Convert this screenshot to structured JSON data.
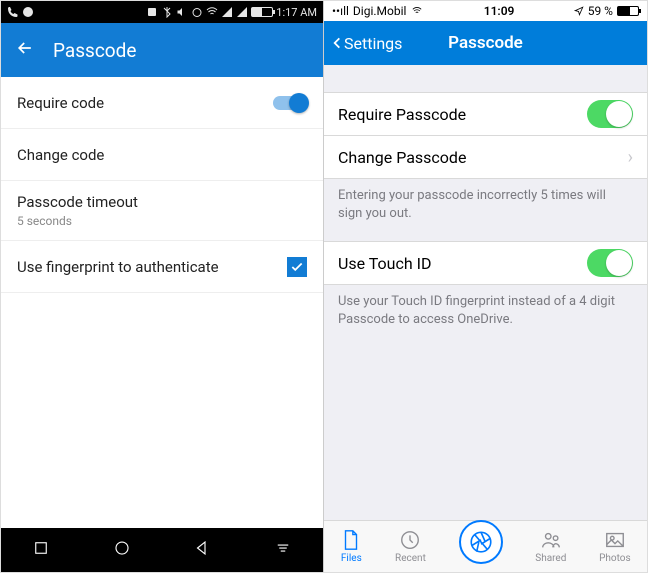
{
  "android": {
    "status": {
      "time": "1:17 AM"
    },
    "header": {
      "title": "Passcode"
    },
    "rows": {
      "require": {
        "label": "Require code",
        "on": true
      },
      "change": {
        "label": "Change code"
      },
      "timeout": {
        "label": "Passcode timeout",
        "sub": "5 seconds"
      },
      "fingerprint": {
        "label": "Use fingerprint to authenticate",
        "checked": true
      }
    }
  },
  "ios": {
    "status": {
      "carrier": "Digi.Mobil",
      "time": "11:09",
      "battery": "59 %"
    },
    "header": {
      "back": "Settings",
      "title": "Passcode"
    },
    "rows": {
      "require": {
        "label": "Require Passcode",
        "on": true
      },
      "change": {
        "label": "Change Passcode"
      },
      "touchid": {
        "label": "Use Touch ID",
        "on": true
      }
    },
    "notes": {
      "incorrect": "Entering your passcode incorrectly 5 times will sign you out.",
      "touchid": "Use your Touch ID fingerprint instead of a 4 digit Passcode to access OneDrive."
    },
    "tabs": {
      "files": "Files",
      "recent": "Recent",
      "shared": "Shared",
      "photos": "Photos"
    }
  }
}
